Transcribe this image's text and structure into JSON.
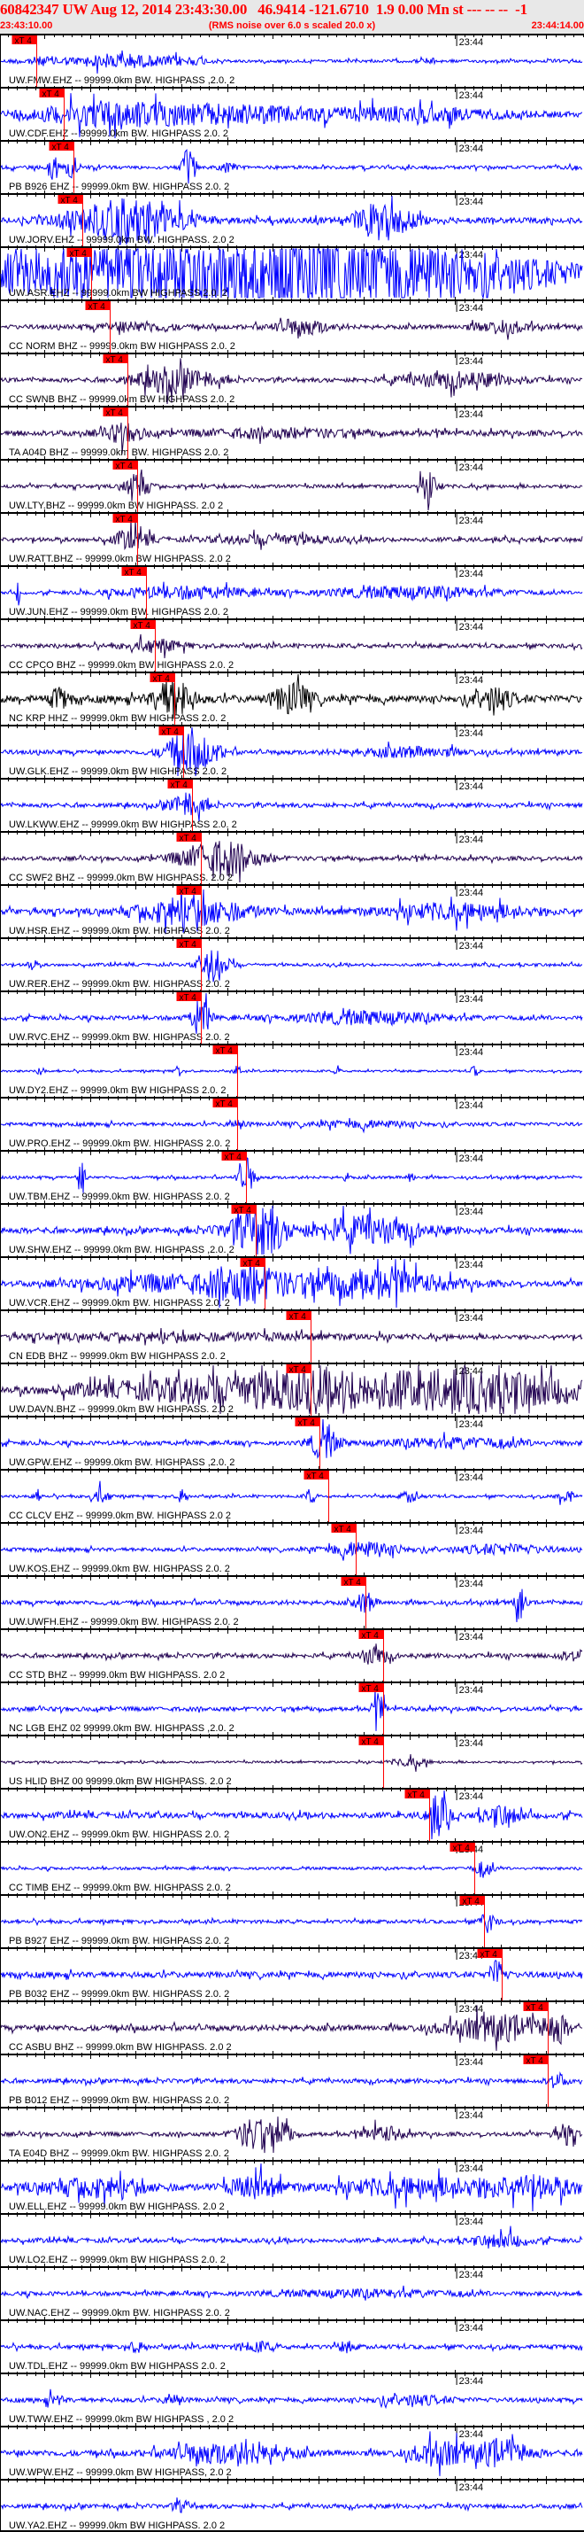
{
  "header": {
    "title": "60842347 UW Aug 12, 2014 23:43:30.00   46.9414 -121.6710  1.9 0.00 Mn st --- -- --  -1",
    "start_time": "23:43:10.00",
    "note": "(RMS noise over 6.0 s scaled 20.0 x)",
    "end_time": "23:44:14.00"
  },
  "chart_data": {
    "type": "line",
    "title": "60842347 UW Aug 12, 2014 23:43:30.00",
    "x_range_s": [
      0,
      64
    ],
    "tick_interval_s": 5,
    "tick_label": "23:44",
    "tick_label_at_s": 50,
    "colors": {
      "blue": "#0000ff",
      "purple": "#200050",
      "black": "#000000",
      "pick": "#ff0000",
      "header_text": "#ff0000"
    },
    "traces": [
      {
        "label": "UW.FMW.EHZ -- 99999.0km BW. HIGHPASS ,2.0. 2",
        "color": "blue",
        "pick_label": "xT 4",
        "pick_s": 3.98
      },
      {
        "label": "UW.CDF.EHZ -- 99999.0km BW. HIGHPASS  2.0. 2",
        "color": "blue",
        "pick_label": "xT 4",
        "pick_s": 6.98
      },
      {
        "label": "PB B926 EHZ -- 99999.0km BW. HIGHPASS  2.0. 2",
        "color": "blue",
        "pick_label": "xT 4",
        "pick_s": 8.05
      },
      {
        "label": "UW.JORV.EHZ -- 99999.0km BW. HIGHPASS. 2.0  2",
        "color": "blue",
        "pick_label": "xT 4",
        "pick_s": 9.02
      },
      {
        "label": "UW.ASR.EHZ -- 99999.0km BW  HIGHPASS  2.0. 2",
        "color": "blue",
        "pick_label": "xT 4",
        "pick_s": 9.99
      },
      {
        "label": "CC NORM BHZ -- 99999.0km BW  HIGHPASS  2.0. 2",
        "color": "purple",
        "pick_label": "xT 4",
        "pick_s": 12.02
      },
      {
        "label": "CC SWNB BHZ -- 99999.0km BW  HIGHPASS  2.0. 2",
        "color": "purple",
        "pick_label": "xT 4",
        "pick_s": 13.96
      },
      {
        "label": "TA A04D BHZ -- 99999.0km BW. HIGHPASS  2.0. 2",
        "color": "purple",
        "pick_label": "xT 4",
        "pick_s": 13.96
      },
      {
        "label": "UW.LTY.BHZ -- 99999.0km BW  HIGHPASS. 2.0  2",
        "color": "purple",
        "pick_label": "xT 4",
        "pick_s": 15.03
      },
      {
        "label": "UW.RATT.BHZ -- 99999.0km BW  HIGHPASS. 2.0  2",
        "color": "purple",
        "pick_label": "xT 4",
        "pick_s": 15.03
      },
      {
        "label": "UW.JUN.EHZ -- 99999.0km BW. HIGHPASS  2.0. 2",
        "color": "blue",
        "pick_label": "xT 4",
        "pick_s": 16.0
      },
      {
        "label": "CC CPCO BHZ -- 99999.0km BW  HIGHPASS  2.0. 2",
        "color": "purple",
        "pick_label": "xT 4",
        "pick_s": 16.97
      },
      {
        "label": "NC KRP HHZ -- 99999.0km BW  HIGHPASS  2.0. 2",
        "color": "black",
        "pick_label": "xT 4",
        "pick_s": 19.1
      },
      {
        "label": "UW.GLK.EHZ -- 99999.0km BW  HIGHPASS  2.0. 2",
        "color": "blue",
        "pick_label": "xT 4",
        "pick_s": 20.07
      },
      {
        "label": "UW.LKWW.EHZ -- 99999.0km BW  HIGHPASS  2.0. 2",
        "color": "blue",
        "pick_label": "xT 4",
        "pick_s": 21.04
      },
      {
        "label": "CC SWF2 BHZ -- 99999.0km BW  HIGHPASS. 2.0  2",
        "color": "purple",
        "pick_label": "xT 4",
        "pick_s": 22.01
      },
      {
        "label": "UW.HSR.EHZ -- 99999.0km BW. HIGHPASS  2.0. 2",
        "color": "blue",
        "pick_label": "xT 4",
        "pick_s": 22.01
      },
      {
        "label": "UW.RER.EHZ -- 99999.0km BW. HIGHPASS  2.0. 2",
        "color": "blue",
        "pick_label": "xT 4",
        "pick_s": 22.01
      },
      {
        "label": "UW.RVC.EHZ -- 99999.0km BW. HIGHPASS  2.0. 2",
        "color": "blue",
        "pick_label": "xT 4",
        "pick_s": 22.01
      },
      {
        "label": "UW.DY2.EHZ -- 99999.0km BW  HIGHPASS  2.0. 2",
        "color": "blue",
        "pick_label": "xT 4",
        "pick_s": 25.99
      },
      {
        "label": "UW.PRO.EHZ -- 99999.0km BW. HIGHPASS  2.0. 2",
        "color": "blue",
        "pick_label": "xT 4",
        "pick_s": 25.99
      },
      {
        "label": "UW.TBM.EHZ -- 99999.0km BW. HIGHPASS  2.0. 2",
        "color": "blue",
        "pick_label": "xT 4",
        "pick_s": 26.96
      },
      {
        "label": "UW.SHW.EHZ -- 99999.0km BW. HIGHPASS ,2.0. 2",
        "color": "blue",
        "pick_label": "xT 4",
        "pick_s": 28.02
      },
      {
        "label": "UW.VCR.EHZ -- 99999.0km BW. HIGHPASS  2.0. 2",
        "color": "blue",
        "pick_label": "xT 4",
        "pick_s": 28.99
      },
      {
        "label": "CN EDB BHZ -- 99999.0km BW  HIGHPASS  2.0. 2",
        "color": "purple",
        "pick_label": "xT 4",
        "pick_s": 34.04
      },
      {
        "label": "UW.DAVN.BHZ -- 99999.0km BW  HIGHPASS. 2.0  2",
        "color": "purple",
        "pick_label": "xT 4",
        "pick_s": 34.04
      },
      {
        "label": "UW.GPW.EHZ -- 99999.0km BW. HIGHPASS ,2.0. 2",
        "color": "blue",
        "pick_label": "xT 4",
        "pick_s": 35.0
      },
      {
        "label": "CC CLCV EHZ -- 99999.0km BW. HIGHPASS  2.0  2",
        "color": "blue",
        "pick_label": "xT 4",
        "pick_s": 35.98
      },
      {
        "label": "UW.KOS.EHZ -- 99999.0km BW. HIGHPASS  2.0. 2",
        "color": "blue",
        "pick_label": "xT 4",
        "pick_s": 38.98
      },
      {
        "label": "UW.UWFH.EHZ -- 99999.0km BW. HIGHPASS  2.0. 2",
        "color": "blue",
        "pick_label": "xT 4",
        "pick_s": 40.05
      },
      {
        "label": "CC STD BHZ -- 99999.0km BW  HIGHPASS. 2.0  2",
        "color": "purple",
        "pick_label": "xT 4",
        "pick_s": 41.99
      },
      {
        "label": "NC LGB EHZ 02 99999.0km BW. HIGHPASS ,2.0. 2",
        "color": "blue",
        "pick_label": "xT 4",
        "pick_s": 41.99
      },
      {
        "label": "US HLID BHZ 00 99999.0km BW  HIGHPASS. 2.0  2",
        "color": "purple",
        "pick_label": "xT 4",
        "pick_s": 41.99
      },
      {
        "label": "UW.ON2.EHZ -- 99999.0km BW. HIGHPASS  2.0. 2",
        "color": "blue",
        "pick_label": "xT 4",
        "pick_s": 47.03
      },
      {
        "label": "CC TIMB EHZ -- 99999.0km BW. HIGHPASS  2.0. 2",
        "color": "blue",
        "pick_label": "xT 4",
        "pick_s": 51.98
      },
      {
        "label": "PB B927 EHZ -- 99999.0km BW. HIGHPASS  2.0. 2",
        "color": "blue",
        "pick_label": "xT 4",
        "pick_s": 53.04
      },
      {
        "label": "PB B032 EHZ -- 99999.0km BW. HIGHPASS  2.0. 2",
        "color": "blue",
        "pick_label": "xT 4",
        "pick_s": 54.98
      },
      {
        "label": "CC ASBU BHZ -- 99999.0km BW  HIGHPASS. 2.0  2",
        "color": "purple",
        "pick_label": "xT 4",
        "pick_s": 60.02
      },
      {
        "label": "PB B012 EHZ -- 99999.0km BW. HIGHPASS  2.0. 2",
        "color": "blue",
        "pick_label": "xT 4",
        "pick_s": 60.02
      },
      {
        "label": "TA E04D BHZ -- 99999.0km BW. HIGHPASS  2.0. 2",
        "color": "purple"
      },
      {
        "label": "UW.ELL.EHZ -- 99999.0km BW  HIGHPASS. 2.0  2",
        "color": "blue"
      },
      {
        "label": "UW.LO2.EHZ -- 99999.0km BW  HIGHPASS  2.0. 2",
        "color": "blue"
      },
      {
        "label": "UW.NAC.EHZ -- 99999.0km BW. HIGHPASS  2.0. 2",
        "color": "blue"
      },
      {
        "label": "UW.TDL.EHZ -- 99999.0km BW  HIGHPASS  2.0. 2",
        "color": "blue"
      },
      {
        "label": "UW.TWW.EHZ -- 99999.0km BW  HIGHPASS , 2.0  2",
        "color": "blue"
      },
      {
        "label": "UW.WPW.EHZ -- 99999.0km BW  HIGHPASS, 2.0  2",
        "color": "blue"
      },
      {
        "label": "UW.YA2.EHZ -- 99999.0km BW  HIGHPASS. 2.0  2",
        "color": "blue"
      }
    ]
  }
}
